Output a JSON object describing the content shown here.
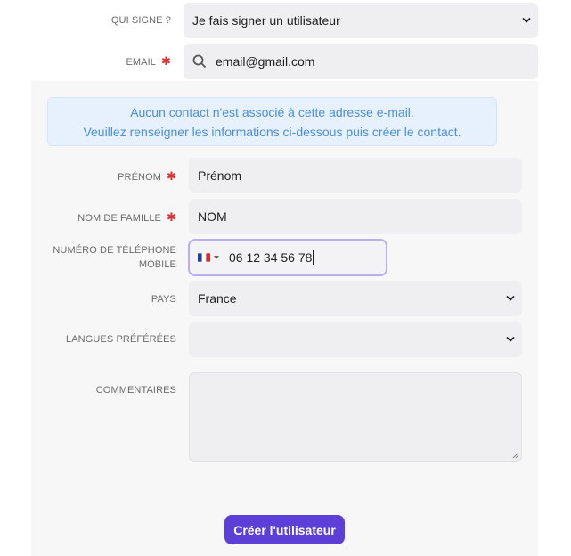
{
  "who_signs": {
    "label": "QUI SIGNE ?",
    "value": "Je fais signer un utilisateur"
  },
  "email": {
    "label": "EMAIL",
    "value": "email@gmail.com",
    "required_mark": "✱"
  },
  "notice": {
    "line1": "Aucun contact n'est associé à cette adresse e-mail.",
    "line2": "Veuillez renseigner les informations ci-dessous puis créer le contact."
  },
  "form": {
    "first_name": {
      "label": "PRÉNOM",
      "value": "Prénom",
      "required_mark": "✱"
    },
    "last_name": {
      "label": "NOM DE FAMILLE",
      "value": "NOM",
      "required_mark": "✱"
    },
    "phone": {
      "label_line1": "NUMÉRO DE TÉLÉPHONE",
      "label_line2": "MOBILE",
      "value": "06 12 34 56 78",
      "country_flag": "FR"
    },
    "country": {
      "label": "PAYS",
      "value": "France"
    },
    "languages": {
      "label": "LANGUES PRÉFÉRÉES",
      "value": ""
    },
    "comments": {
      "label": "COMMENTAIRES",
      "value": ""
    }
  },
  "submit": {
    "label": "Créer l'utilisateur"
  },
  "colors": {
    "accent": "#5b3fd6",
    "required": "#e0312f",
    "notice_text": "#4a8fd8",
    "notice_bg": "#e7f0fd",
    "field_bg": "#efeff1"
  }
}
